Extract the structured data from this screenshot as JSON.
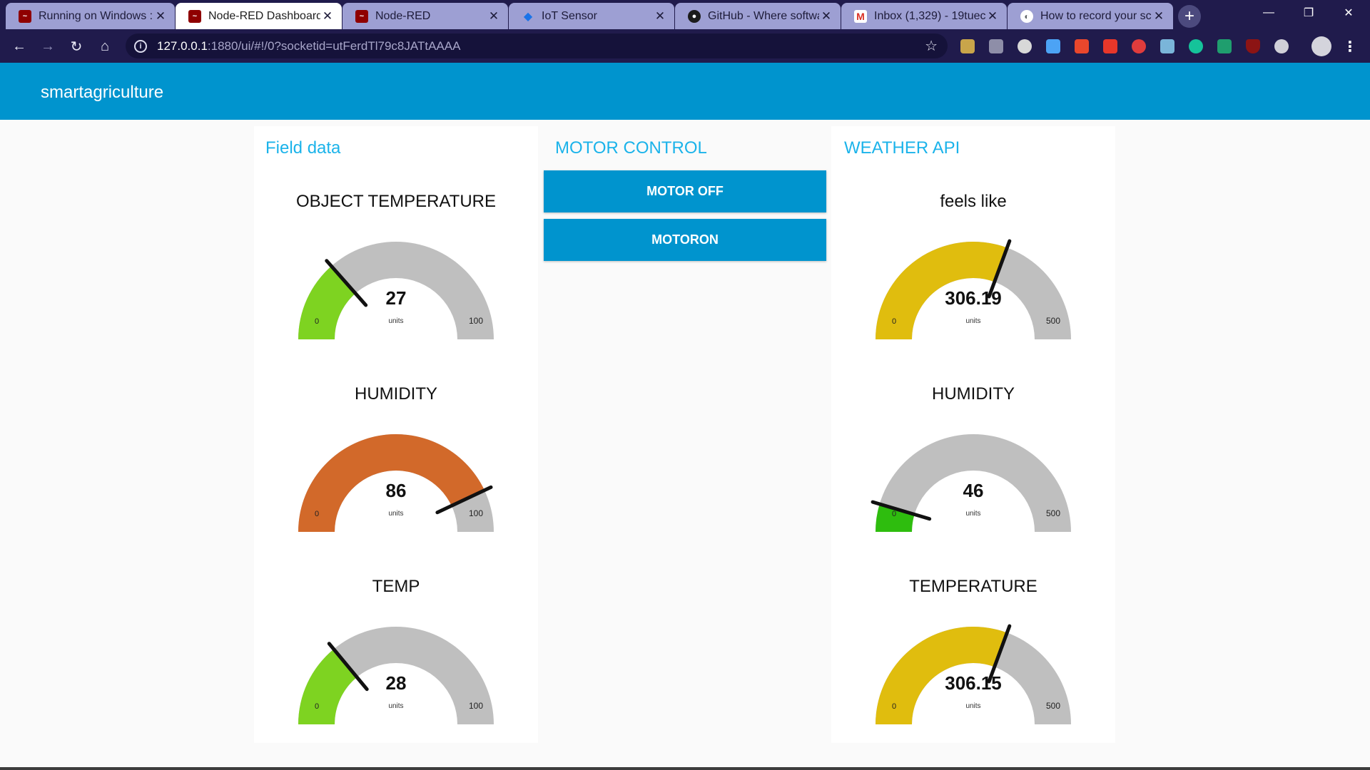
{
  "browser": {
    "tabs": [
      {
        "title": "Running on Windows :",
        "icon": "node-red-icon",
        "active": false
      },
      {
        "title": "Node-RED Dashboard",
        "icon": "node-red-icon",
        "active": true
      },
      {
        "title": "Node-RED",
        "icon": "node-red-icon",
        "active": false
      },
      {
        "title": "IoT Sensor",
        "icon": "iot-icon",
        "active": false
      },
      {
        "title": "GitHub - Where softwa",
        "icon": "github-icon",
        "active": false
      },
      {
        "title": "Inbox (1,329) - 19tuec",
        "icon": "gmail-icon",
        "active": false
      },
      {
        "title": "How to record your scr",
        "icon": "web-icon",
        "active": false
      }
    ],
    "url_host": "127.0.0.1",
    "url_path": ":1880/ui/#!/0?socketid=utFerdTl79c8JATtAAAA"
  },
  "dashboard": {
    "title": "smartagriculture",
    "groups": {
      "field": {
        "title": "Field data",
        "gauges": [
          {
            "label": "OBJECT TEMPERATURE",
            "value": "27",
            "units": "units",
            "min": "0",
            "max": "100",
            "fraction": 0.27,
            "color": "#7ed321"
          },
          {
            "label": "HUMIDITY",
            "value": "86",
            "units": "units",
            "min": "0",
            "max": "100",
            "fraction": 0.86,
            "color": "#d2692a"
          },
          {
            "label": "TEMP",
            "value": "28",
            "units": "units",
            "min": "0",
            "max": "100",
            "fraction": 0.28,
            "color": "#7ed321"
          }
        ]
      },
      "motor": {
        "title": "MOTOR CONTROL",
        "buttons": [
          "MOTOR OFF",
          "MOTORON"
        ]
      },
      "weather": {
        "title": "WEATHER API",
        "gauges": [
          {
            "label": "feels like",
            "value": "306.19",
            "units": "units",
            "min": "0",
            "max": "500",
            "fraction": 0.61238,
            "color": "#e0bd0e"
          },
          {
            "label": "HUMIDITY",
            "value": "46",
            "units": "units",
            "min": "0",
            "max": "500",
            "fraction": 0.092,
            "color": "#2ebd0e"
          },
          {
            "label": "TEMPERATURE",
            "value": "306.15",
            "units": "units",
            "min": "0",
            "max": "500",
            "fraction": 0.6123,
            "color": "#e0bd0e"
          }
        ]
      }
    },
    "colors": {
      "header": "#0094ce",
      "group_title": "#1bb3ea",
      "gauge_track": "#bfbfbf",
      "needle": "#111111"
    }
  }
}
